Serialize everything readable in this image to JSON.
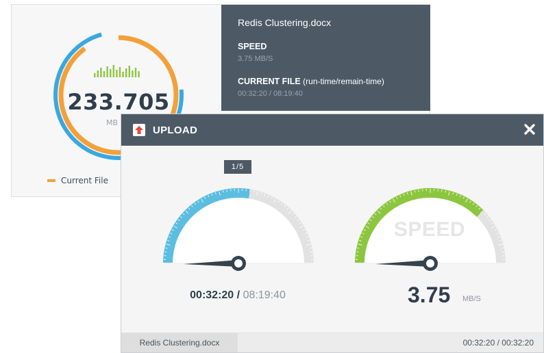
{
  "background_window": {
    "total_value": "233.705",
    "total_unit": "MB",
    "current_file_progress": 0.9,
    "legend_label": "Current File",
    "file_name": "Redis Clustering.docx",
    "speed_label": "SPEED",
    "speed_value": "3.75 MB/S",
    "current_file_label": "CURRENT FILE",
    "current_file_sublabel": "(run-time/remain-time)",
    "current_file_times": "00:32:20 / 08:19:40",
    "colors": {
      "outer_ring": "#3aa8df",
      "inner_ring": "#f2a13a",
      "wave": "#8cc63f"
    }
  },
  "upload_dialog": {
    "title": "UPLOAD",
    "upload_icon": "upload-arrow-icon",
    "close_icon": "close-x-icon",
    "page_indicator": "1/5",
    "time_gauge": {
      "progress": 0.55,
      "run_time": "00:32:20",
      "separator": "/",
      "remain_time": "08:19:40",
      "color": "#5bbde0"
    },
    "speed_gauge": {
      "progress": 0.75,
      "watermark": "SPEED",
      "value": "3.75",
      "unit": "MB/S",
      "color": "#8cc63f"
    },
    "footer": {
      "file_name": "Redis Clustering.docx",
      "times": "00:32:20 / 00:32:20"
    }
  }
}
